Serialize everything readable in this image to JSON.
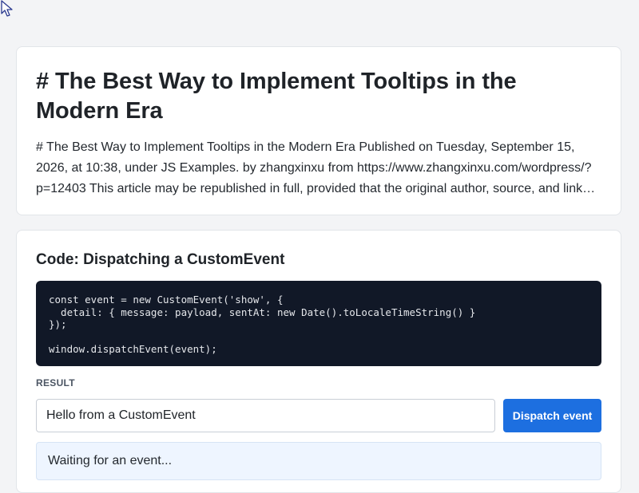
{
  "article": {
    "title": "# The Best Way to Implement Tooltips in the Modern Era",
    "excerpt": "# The Best Way to Implement Tooltips in the Modern Era Published on Tuesday, September 15, 2026, at 10:38, under JS Examples. by zhangxinxu from https://www.zhangxinxu.com/wordpress/?p=12403 This article may be republished in full, provided that the original author, source, and link are credited."
  },
  "demo": {
    "title": "Code: Dispatching a CustomEvent",
    "code": "const event = new CustomEvent('show', {\n  detail: { message: payload, sentAt: new Date().toLocaleTimeString() }\n});\n\nwindow.dispatchEvent(event);",
    "result_label": "RESULT",
    "input_value": "Hello from a CustomEvent",
    "button_label": "Dispatch event",
    "output_text": "Waiting for an event..."
  },
  "icons": {
    "cursor": "mouse-pointer-icon"
  },
  "colors": {
    "page_background": "#f3f4f6",
    "code_background": "#111827",
    "accent_button": "#1d6fe0",
    "output_background": "#eef5ff"
  }
}
